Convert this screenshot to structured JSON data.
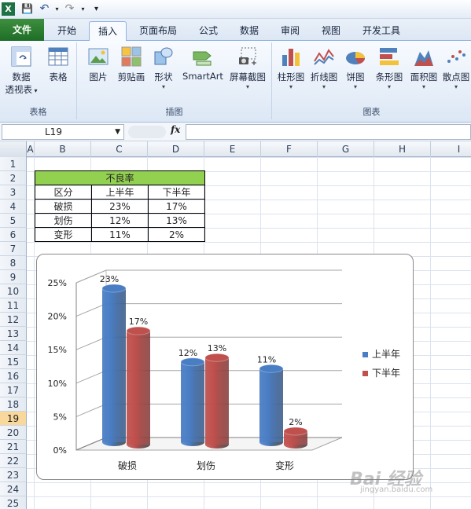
{
  "qat": {
    "icons": [
      "excel-logo-icon",
      "save-icon",
      "undo-icon",
      "redo-icon",
      "customize-icon"
    ]
  },
  "tabs": [
    {
      "label": "文件",
      "name": "tab-file"
    },
    {
      "label": "开始",
      "name": "tab-home"
    },
    {
      "label": "插入",
      "name": "tab-insert",
      "active": true
    },
    {
      "label": "页面布局",
      "name": "tab-page-layout"
    },
    {
      "label": "公式",
      "name": "tab-formulas"
    },
    {
      "label": "数据",
      "name": "tab-data"
    },
    {
      "label": "审阅",
      "name": "tab-review"
    },
    {
      "label": "视图",
      "name": "tab-view"
    },
    {
      "label": "开发工具",
      "name": "tab-developer"
    }
  ],
  "ribbon": {
    "groups": {
      "tables": "表格",
      "illustrations": "插图",
      "charts": "图表"
    },
    "buttons": {
      "pivot_line1": "数据",
      "pivot_line2": "透视表",
      "table": "表格",
      "picture": "图片",
      "clipart": "剪贴画",
      "shapes": "形状",
      "smartart": "SmartArt",
      "screenshot": "屏幕截图",
      "column": "柱形图",
      "line": "折线图",
      "pie": "饼图",
      "bar": "条形图",
      "area": "面积图",
      "scatter": "散点图"
    }
  },
  "formula_bar": {
    "name_box": "L19",
    "fx": "fx",
    "formula": ""
  },
  "columns": [
    "A",
    "B",
    "C",
    "D",
    "E",
    "F",
    "G",
    "H",
    "I"
  ],
  "rows": [
    "1",
    "2",
    "3",
    "4",
    "5",
    "6",
    "7",
    "8",
    "9",
    "10",
    "11",
    "12",
    "13",
    "14",
    "15",
    "16",
    "17",
    "18",
    "19",
    "20",
    "21",
    "22",
    "23",
    "24",
    "25"
  ],
  "selected_row": "19",
  "table": {
    "title": "不良率",
    "headers": [
      "区分",
      "上半年",
      "下半年"
    ],
    "rows": [
      [
        "破损",
        "23%",
        "17%"
      ],
      [
        "划伤",
        "12%",
        "13%"
      ],
      [
        "变形",
        "11%",
        "2%"
      ]
    ]
  },
  "chart_data": {
    "type": "bar",
    "categories": [
      "破损",
      "划伤",
      "变形"
    ],
    "series": [
      {
        "name": "上半年",
        "values": [
          23,
          12,
          11
        ],
        "labels": [
          "23%",
          "12%",
          "11%"
        ],
        "color": "#4a7ec4"
      },
      {
        "name": "下半年",
        "values": [
          17,
          13,
          2
        ],
        "labels": [
          "17%",
          "13%",
          "2%"
        ],
        "color": "#c0504d"
      }
    ],
    "yticks": [
      "0%",
      "5%",
      "10%",
      "15%",
      "20%",
      "25%"
    ],
    "ylim": [
      0,
      25
    ],
    "grid": true,
    "legend": "right",
    "style": "3d-cylinder"
  },
  "watermark": {
    "text": "Bai 经验",
    "sub": "jingyan.baidu.com"
  }
}
